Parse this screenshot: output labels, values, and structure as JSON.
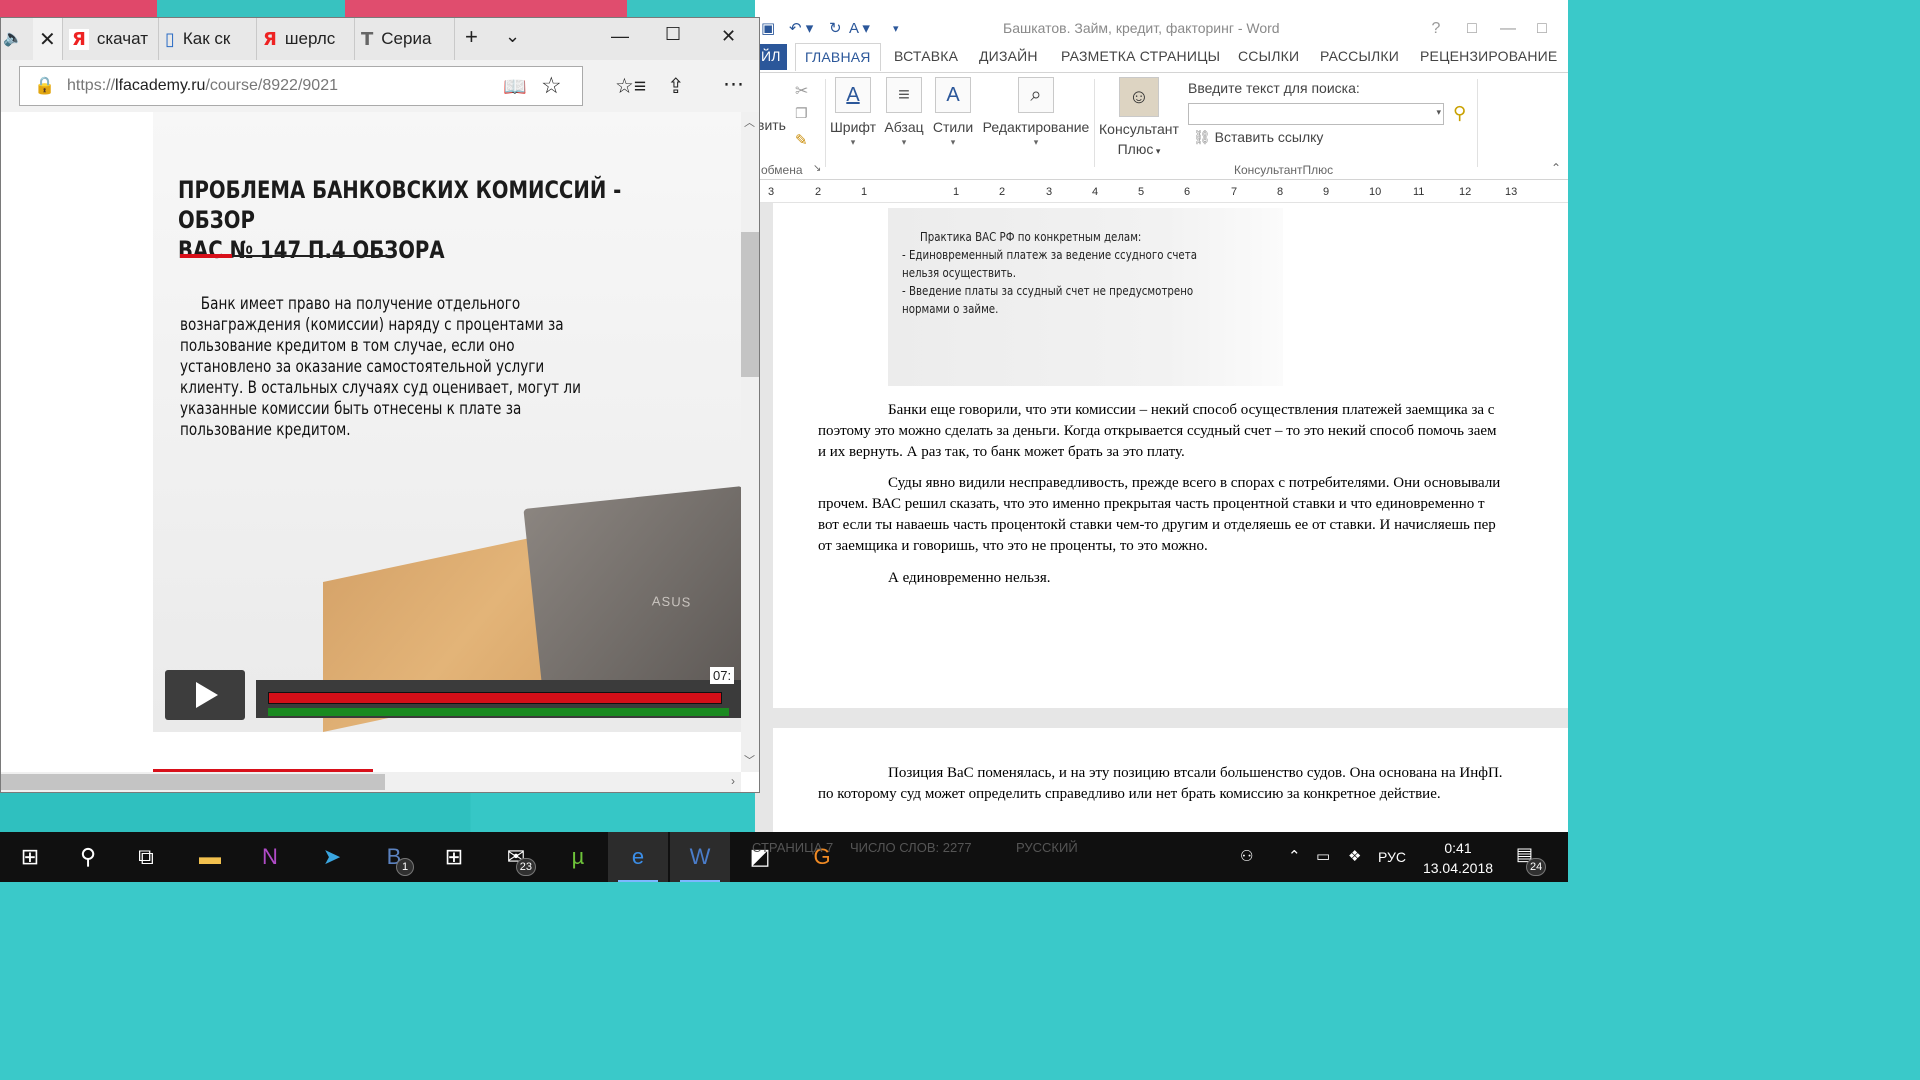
{
  "word": {
    "title": "Башкатов. Займ, кредит, факторинг - Word",
    "window_controls": [
      "?",
      "□",
      "—",
      "□"
    ],
    "tabs": [
      "ЙЛ",
      "ГЛАВНАЯ",
      "ВСТАВКА",
      "ДИЗАЙН",
      "РАЗМЕТКА СТРАНИЦЫ",
      "ССЫЛКИ",
      "РАССЫЛКИ",
      "РЕЦЕНЗИРОВАНИЕ"
    ],
    "ribbon": {
      "paste_label": "вить",
      "clipboard_label": "обмена",
      "font_label": "Шрифт",
      "paragraph_label": "Абзац",
      "styles_label": "Стили",
      "editing_label": "Редактирование",
      "consultant_label_1": "Консультант",
      "consultant_label_2": "Плюс",
      "search_label": "Введите текст для поиска:",
      "insert_link_label": "Вставить ссылку",
      "group_label": "КонсультантПлюс"
    },
    "ruler_numbers": [
      "3",
      "2",
      "1",
      "1",
      "2",
      "3",
      "4",
      "5",
      "6",
      "7",
      "8",
      "9",
      "10",
      "11",
      "12",
      "13"
    ],
    "image_text": [
      "Практика ВАС РФ по конкретным делам:",
      "- Единовременный платеж за ведение ссудного счета",
      "нельзя осуществить.",
      "- Введение платы за ссудный счет не предусмотрено",
      "нормами о займе."
    ],
    "paragraphs": [
      [
        "Банки еще говорили, что эти комиссии – некий способ осуществления платежей заемщика за с",
        "поэтому это можно сделать за деньги. Когда открывается ссудный счет – то это некий способ помочь заем",
        "и их вернуть. А раз так, то банк может брать за это плату."
      ],
      [
        "Суды явно видили несправедливость, прежде всего в спорах с потребителями. Они основывали",
        "прочем. ВАС решил сказать, что это именно прекрытая часть процентной ставки и что единовременно т",
        "вот если ты наваешь часть процентокй ставки чем-то другим и отделяешь ее от ставки. И начисляешь пер",
        "от заемщика и говоришь, что это не проценты, то это можно."
      ],
      [
        "А единовременно нельзя."
      ]
    ],
    "page2_paragraph": [
      "Позиция ВаС поменялась, и на эту позицию втсали большенство судов. Она основана на  ИнфП. ",
      "по которому суд может определить справедливо или нет брать комиссию за конкретное действие."
    ],
    "status_page": "СТРАНИЦА 7",
    "status_words": "ЧИСЛО СЛОВ: 2277",
    "status_lang": "РУССКИЙ"
  },
  "edge": {
    "tabs": [
      {
        "icon": "Я",
        "label": "скачат"
      },
      {
        "icon": "▯",
        "label": "Как ск"
      },
      {
        "icon": "Я",
        "label": "шерлс"
      },
      {
        "icon": "T",
        "label": "Сериа"
      }
    ],
    "url_prefix": "https://",
    "url_domain": "lfacademy.ru",
    "url_path": "/course/8922/9021",
    "slide": {
      "title_1": "ПРОБЛЕМА БАНКОВСКИХ КОМИССИЙ - ОБЗОР",
      "title_2": "ВАС № 147 П.4 ОБЗОРА",
      "body": [
        "Банк имеет право на получение отдельного",
        "вознаграждения (комиссии) наряду с процентами за",
        "пользование кредитом в том случае, если оно",
        "установлено за оказание самостоятельной услуги",
        "клиенту. В остальных случаях суд оценивает, могут ли",
        "указанные комиссии быть отнесены к плате за",
        "пользование кредитом."
      ],
      "laptop_logo": "ASUS",
      "time_label": "07:",
      "buffered_fraction": 0.985,
      "played_fraction": 1.0
    }
  },
  "taskbar": {
    "badges": {
      "vk": "1",
      "mail": "23"
    },
    "lang": "РУС",
    "time": "0:41",
    "date": "13.04.2018",
    "notifications": "24"
  },
  "colors": {
    "word_blue": "#2b579a",
    "slide_red": "#d8101a",
    "progress_green": "#1a8a20",
    "taskbar": "#101010"
  }
}
